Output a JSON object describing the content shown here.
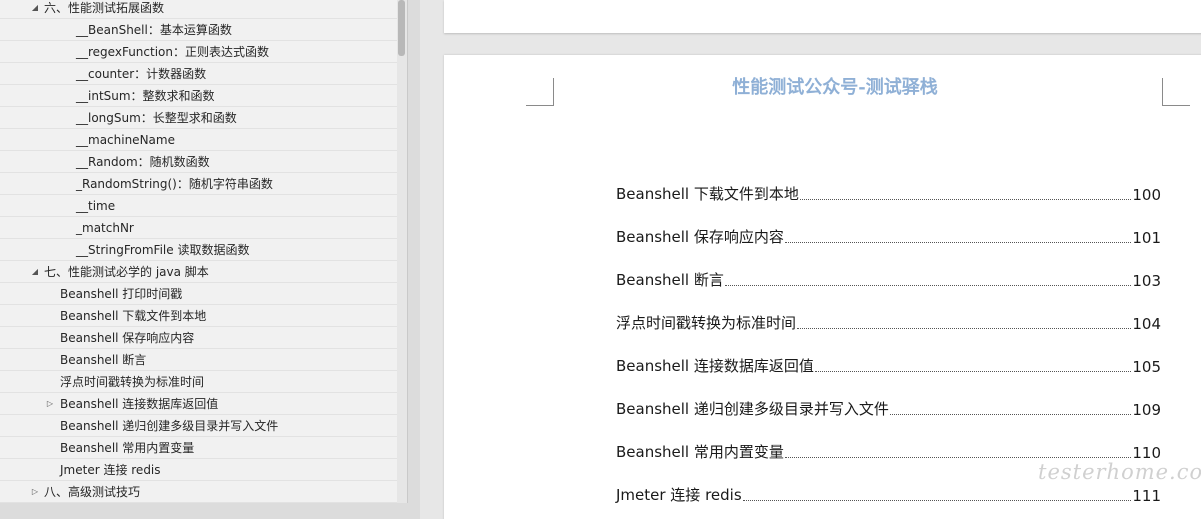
{
  "nav": {
    "items": [
      {
        "label": "六、性能测试拓展函数",
        "level": 1,
        "expander": "expanded"
      },
      {
        "label": "__BeanShell：基本运算函数",
        "level": 3,
        "expander": "none"
      },
      {
        "label": "__regexFunction：正则表达式函数",
        "level": 3,
        "expander": "none"
      },
      {
        "label": "__counter：计数器函数",
        "level": 3,
        "expander": "none"
      },
      {
        "label": "__intSum：整数求和函数",
        "level": 3,
        "expander": "none"
      },
      {
        "label": "__longSum：长整型求和函数",
        "level": 3,
        "expander": "none"
      },
      {
        "label": "__machineName",
        "level": 3,
        "expander": "none"
      },
      {
        "label": "__Random：随机数函数",
        "level": 3,
        "expander": "none"
      },
      {
        "label": "_RandomString()：随机字符串函数",
        "level": 3,
        "expander": "none"
      },
      {
        "label": "__time",
        "level": 3,
        "expander": "none"
      },
      {
        "label": "_matchNr",
        "level": 3,
        "expander": "none"
      },
      {
        "label": "__StringFromFile 读取数据函数",
        "level": 3,
        "expander": "none"
      },
      {
        "label": "七、性能测试必学的 java 脚本",
        "level": 1,
        "expander": "expanded"
      },
      {
        "label": "Beanshell 打印时间戳",
        "level": 2,
        "expander": "none"
      },
      {
        "label": "Beanshell 下载文件到本地",
        "level": 2,
        "expander": "none"
      },
      {
        "label": "Beanshell 保存响应内容",
        "level": 2,
        "expander": "none"
      },
      {
        "label": "Beanshell 断言",
        "level": 2,
        "expander": "none"
      },
      {
        "label": "浮点时间戳转换为标准时间",
        "level": 2,
        "expander": "none"
      },
      {
        "label": "Beanshell 连接数据库返回值",
        "level": 2,
        "expander": "collapsed"
      },
      {
        "label": "Beanshell 递归创建多级目录并写入文件",
        "level": 2,
        "expander": "none"
      },
      {
        "label": "Beanshell 常用内置变量",
        "level": 2,
        "expander": "none"
      },
      {
        "label": "Jmeter 连接 redis",
        "level": 2,
        "expander": "none"
      },
      {
        "label": "八、高级测试技巧",
        "level": 1,
        "expander": "collapsed"
      }
    ]
  },
  "document": {
    "header_text": "性能测试公众号-测试驿栈",
    "toc": [
      {
        "title": "Beanshell 下载文件到本地",
        "page": "100"
      },
      {
        "title": "Beanshell 保存响应内容",
        "page": "101"
      },
      {
        "title": "Beanshell 断言",
        "page": "103"
      },
      {
        "title": "浮点时间戳转换为标准时间",
        "page": "104"
      },
      {
        "title": "Beanshell 连接数据库返回值",
        "page": "105"
      },
      {
        "title": "Beanshell 递归创建多级目录并写入文件",
        "page": "109"
      },
      {
        "title": "Beanshell 常用内置变量",
        "page": "110"
      },
      {
        "title": "Jmeter 连接 redis",
        "page": "111"
      }
    ],
    "watermark": "testerhome.com"
  }
}
